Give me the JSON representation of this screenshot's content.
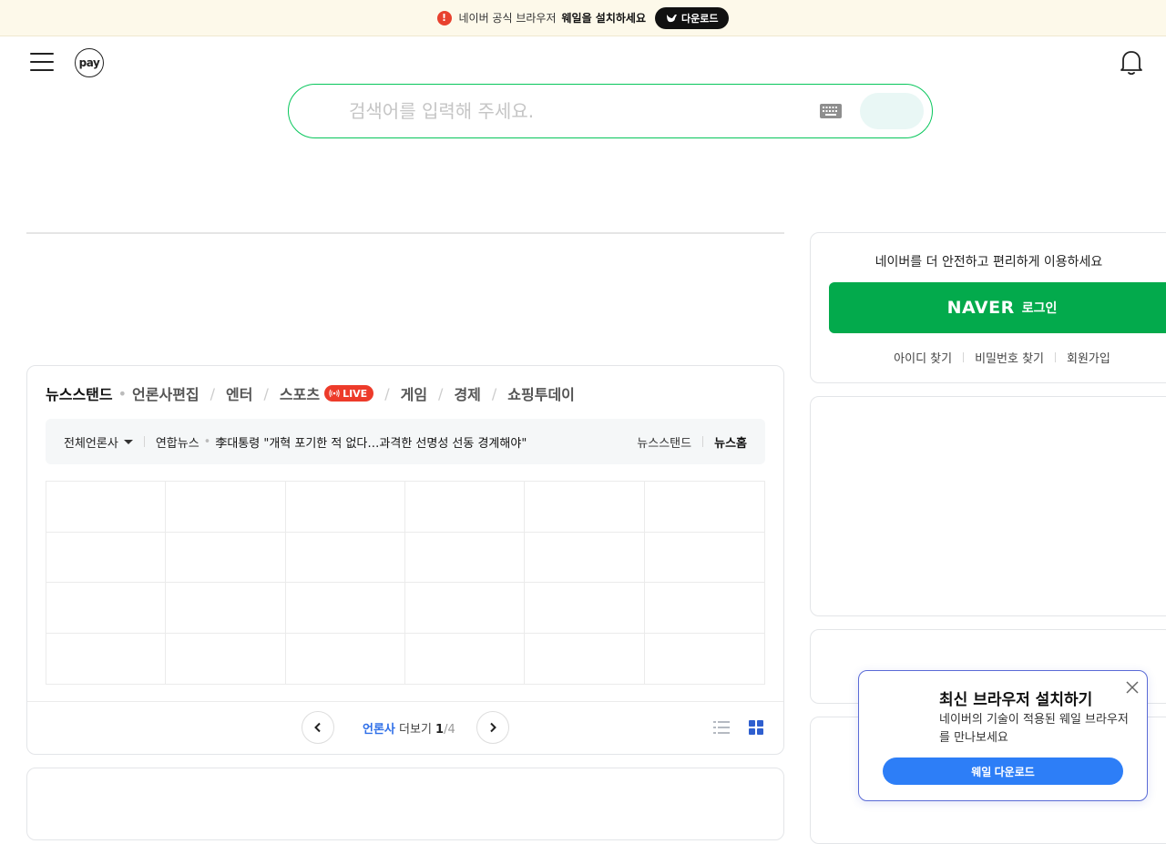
{
  "banner": {
    "text": "네이버 공식 브라우저",
    "strong": "웨일을 설치하세요",
    "download_label": "다운로드"
  },
  "header": {
    "pay_label": "pay"
  },
  "search": {
    "placeholder": "검색어를 입력해 주세요."
  },
  "newsstand": {
    "tabs": [
      {
        "label": "뉴스스탠드"
      },
      {
        "label": "언론사편집"
      },
      {
        "label": "엔터"
      },
      {
        "label": "스포츠",
        "badge": "LIVE"
      },
      {
        "label": "게임"
      },
      {
        "label": "경제"
      },
      {
        "label": "쇼핑투데이"
      }
    ],
    "press_select": "전체언론사",
    "press_name": "연합뉴스",
    "headline": "李대통령 \"개혁 포기한 적 없다…과격한 선명성 선동 경계해야\"",
    "link_newsstand": "뉴스스탠드",
    "link_newshome": "뉴스홈",
    "footer": {
      "label_blue": "언론사",
      "label_rest": " 더보기 ",
      "page_current": "1",
      "page_total": "/4"
    }
  },
  "login": {
    "message": "네이버를 더 안전하고 편리하게 이용하세요",
    "logo": "NAVER",
    "button_label": "로그인",
    "links": [
      "아이디 찾기",
      "비밀번호 찾기",
      "회원가입"
    ]
  },
  "popup": {
    "title": "최신 브라우저 설치하기",
    "desc": "네이버의 기술이 적용된 웨일 브라우저를 만나보세요",
    "button_label": "웨일 다운로드"
  },
  "colors": {
    "brand_green": "#03aa4c",
    "search_border": "#07c65b",
    "live_red": "#ed3b2a",
    "popup_blue": "#2d7ef7"
  }
}
